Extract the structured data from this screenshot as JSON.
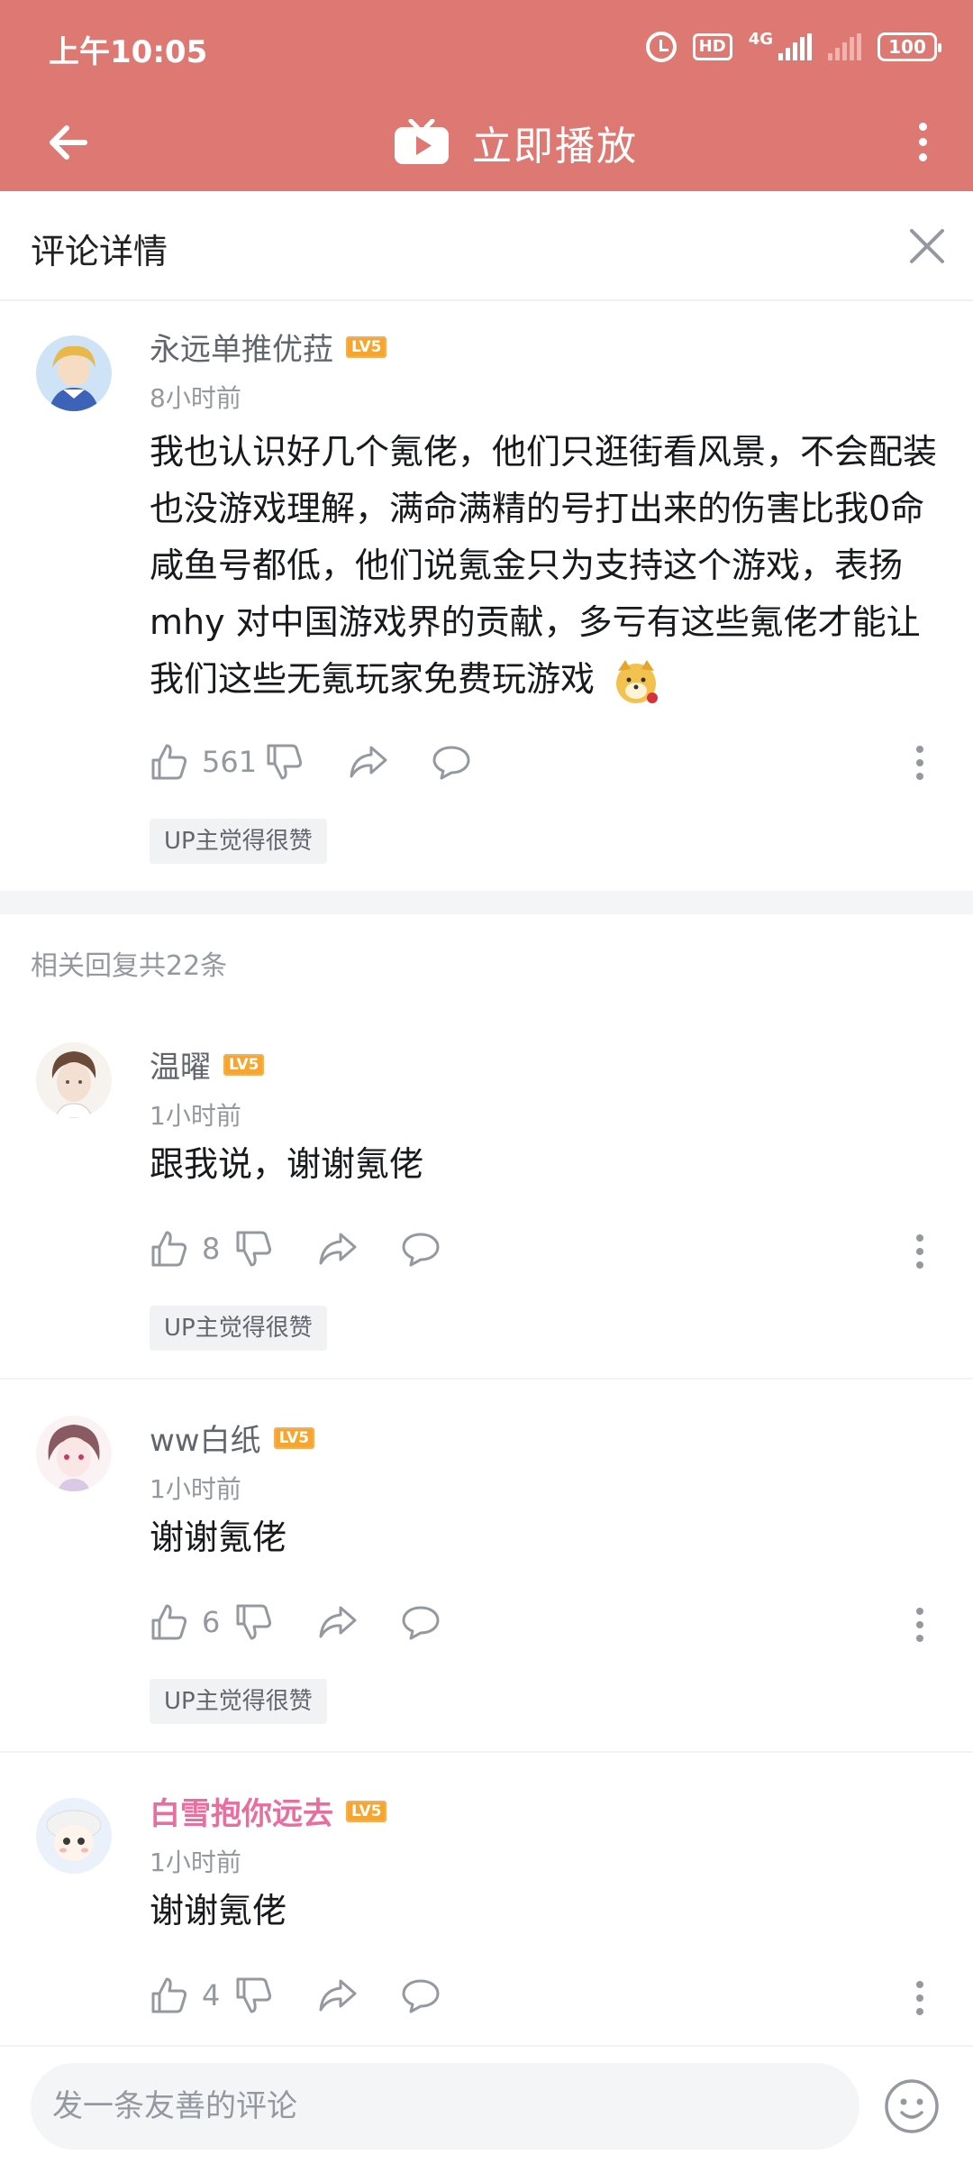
{
  "status_bar": {
    "time": "上午10:05",
    "hd": "HD",
    "network": "4G",
    "battery": "100"
  },
  "app_bar": {
    "title": "立即播放",
    "icons": [
      "back-arrow-icon",
      "tv-play-icon",
      "more-vertical-icon"
    ]
  },
  "sheet": {
    "title": "评论详情"
  },
  "main_comment": {
    "username": "永远单推优菈",
    "level": "LV5",
    "time": "8小时前",
    "text": "我也认识好几个氪佬，他们只逛街看风景，不会配装也没游戏理解，满命满精的号打出来的伤害比我0命咸鱼号都低，他们说氪金只为支持这个游戏，表扬mhy 对中国游戏界的贡献，多亏有这些氪佬才能让我们这些无氪玩家免费玩游戏",
    "likes": "561",
    "badge": "UP主觉得很赞"
  },
  "related_header": "相关回复共22条",
  "replies": [
    {
      "username": "温曜",
      "level": "LV5",
      "time": "1小时前",
      "text": "跟我说，谢谢氪佬",
      "likes": "8",
      "badge": "UP主觉得很赞"
    },
    {
      "username": "ww白纸",
      "level": "LV5",
      "time": "1小时前",
      "text": "谢谢氪佬",
      "likes": "6",
      "badge": "UP主觉得很赞"
    },
    {
      "username": "白雪抱你远去",
      "level": "LV5",
      "time": "1小时前",
      "text": "谢谢氪佬",
      "likes": "4"
    }
  ],
  "footer": {
    "placeholder": "发一条友善的评论"
  },
  "colors": {
    "header_bg": "#de7872",
    "vip_name": "#e86e9f",
    "level_badge": "#f6a630",
    "secondary_text": "#9499a0"
  }
}
